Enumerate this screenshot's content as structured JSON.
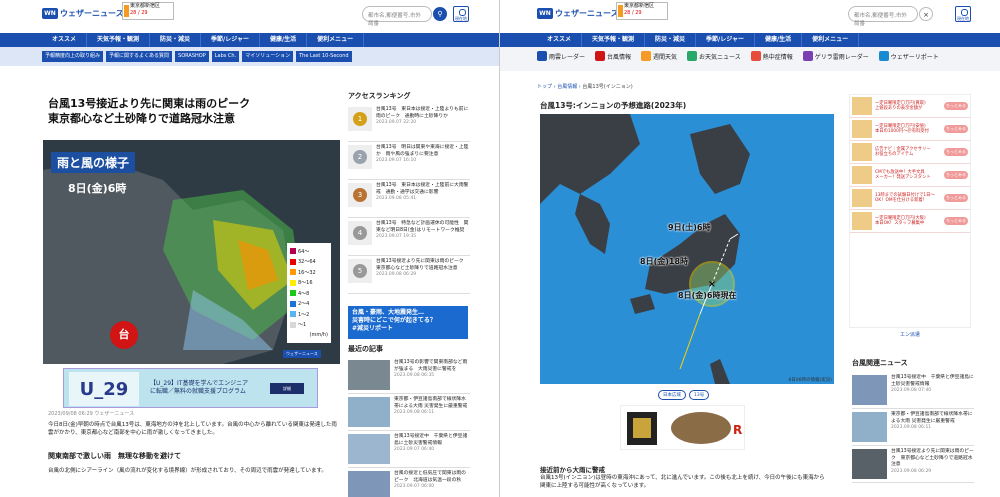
{
  "common": {
    "logo_mark": "WN",
    "logo_text": "ウェザーニュース",
    "weather_badge_location": "東京都新宿区",
    "weather_badge_temp": "28 / 29",
    "search_placeholder": "都市名,郵便番号,市外局番",
    "search_icon": "search-icon",
    "register_label": "現在地",
    "nav": [
      "オススメ",
      "天気予報・観測",
      "防災・減災",
      "季節/レジャー",
      "健康/生活",
      "便利メニュー"
    ]
  },
  "left": {
    "subnav": [
      "予報精度向上の取り組み",
      "予報に関するよくある質問",
      "SORASHOP",
      "Labs Ch.",
      "マイソリューション",
      "The Last 10-Second"
    ],
    "headline": "台風13号接近より先に関東は雨のピーク\n東京都心など土砂降りで道路冠水注意",
    "map": {
      "title": "雨と風の様子",
      "time": "8日(金)6時",
      "legend": [
        {
          "label": "64～",
          "color": "#b4004c"
        },
        {
          "label": "32～64",
          "color": "#e60000"
        },
        {
          "label": "16～32",
          "color": "#ff9900"
        },
        {
          "label": "8～16",
          "color": "#ffee00"
        },
        {
          "label": "4～8",
          "color": "#19c819"
        },
        {
          "label": "2～4",
          "color": "#1976d2"
        },
        {
          "label": "1～2",
          "color": "#5ab4f0"
        },
        {
          "label": "～1",
          "color": "#d8d8d8"
        }
      ],
      "legend_unit": "(mm/h)",
      "typhoon_mark": "台",
      "watermark": "ウェザーニュース"
    },
    "ad": {
      "logo": "U_29",
      "text": "【U_29】IT基礎を学んでエンジニア\nに転職／無料の就職支援プログラム",
      "button": "詳細"
    },
    "date": "2023/09/08 06:29 ウェザーニュース",
    "body1": "今日8日(金)早朝の時点で台風13号は、東海地方の沖を北上しています。台風の中心から離れている関東は発達した雨雲がかかり、東京都心など南部を中心に雨が激しくなってきました。",
    "h3": "関東南部で激しい雨　無理な移動を避けて",
    "body2": "台風の北側にシアーライン（風の流れが変化する境界線）が形成されており、その周辺で雨雲が発達しています。",
    "ranking_title": "アクセスランキング",
    "ranking": [
      {
        "rank": "1",
        "color": "#d4a017",
        "title": "台風13号　東日本は接近・上陸よりも前に雨のピーク　通勤時に土砂降りか",
        "date": "2023.09.07 22:20"
      },
      {
        "rank": "2",
        "color": "#9aa3ad",
        "title": "台風13号　明日は関東や東海に接近・上陸か　雨や風の強まりに要注意",
        "date": "2023.09.07 16:10"
      },
      {
        "rank": "3",
        "color": "#b87333",
        "title": "台風13号　東日本は接近・上陸前に大雨警戒　通勤・通学は交通に影響",
        "date": "2023.09.08 05:41"
      },
      {
        "rank": "4",
        "color": "#888888",
        "title": "台風13号　特急など計画運休の可能性　関東など明日8日(金)はリモートワーク推奨",
        "date": "2023.09.07 19:35"
      },
      {
        "rank": "5",
        "color": "#888888",
        "title": "台風13号接近より先に関東は雨のピーク　東京都心など土砂降りで道路冠水注意",
        "date": "2023.09.08 06:29"
      }
    ],
    "disaster_banner": "台風・豪雨、大地震発生…\n災害時にどこで何が起きてる？\n#減災リポート",
    "recent_title": "最近の記事",
    "recent": [
      {
        "title": "台風13号の影響で関東南部など雨が強まる　大雨災害に警戒を",
        "date": "2023.09.08 06:35"
      },
      {
        "title": "東京都・伊豆諸島南部で線状降水帯による大雨 災害発生に厳重警戒",
        "date": "2023.09.08 06:11"
      },
      {
        "title": "台風13号接近中　千葉県と伊豆諸島に土砂災害警戒情報",
        "date": "2023.09.07 06:40"
      },
      {
        "title": "台風の接近と低気圧で関東は雨のピーク　北海道は気温一段の秋",
        "date": "2023.09.07 06:00"
      }
    ]
  },
  "right": {
    "tabs": [
      {
        "label": "雨雲レーダー",
        "color": "#1a4fb0"
      },
      {
        "label": "台風情報",
        "color": "#d21414"
      },
      {
        "label": "週間天気",
        "color": "#f59a23"
      },
      {
        "label": "お天気ニュース",
        "color": "#2aa86a"
      },
      {
        "label": "熱中症情報",
        "color": "#e74c3c"
      },
      {
        "label": "ゲリラ雷雨レーダー",
        "color": "#7a3fb0"
      },
      {
        "label": "ウェザーリポート",
        "color": "#1a8ad0"
      }
    ],
    "crumb": [
      "トップ",
      "台風情報",
      "台風13号(インニョン)"
    ],
    "title": "台風13号:インニョンの予想進路(2023年)",
    "map": {
      "label9": "9日(土)6時",
      "label8a": "8日(金)18時",
      "label8b": "8日(金)6時現在",
      "caption": "8日06時の情報(実況)"
    },
    "tags": [
      "日本広域",
      "13号"
    ],
    "subh": "接近前から大雨に警戒",
    "body": "台風13号(インニョン)は昼時の東海沖にあって、北に進んでいます。この後も北上を続け、今日の午後にも東海から関東に上陸する可能性が高くなっています。",
    "sidead": [
      {
        "text": "一定日曜限定〇万円(買取)\n上値段ありの表示金額が",
        "btn": "ちっとみる"
      },
      {
        "text": "一定日曜限定〇万円(安値)\n本日の1000円〜＠有料受付",
        "btn": "ちっとみる"
      },
      {
        "text": "広告ナビ｜金属アクセサリー\nお役立ちのアイテム",
        "btn": "ちっとみる"
      },
      {
        "text": "CMでも放送中！大手文具\nメーカー！発送アシスタント",
        "btn": "ちっとみる"
      },
      {
        "text": "13時までの試験日付けで1日〜\nOK！OMを仕分ける新着！",
        "btn": "ちっとみる"
      },
      {
        "text": "一定日曜限定〇万円(大阪)\n本日OK！スタッフ募集中",
        "btn": "ちっとみる"
      }
    ],
    "sidead_foot": "エン派遣",
    "rel_title": "台風関連ニュース",
    "rel": [
      {
        "title": "台風13号接近中　千葉県と伊豆諸島に土砂災害警戒情報",
        "date": "2023.09.08 07:40"
      },
      {
        "title": "東京都・伊豆諸島南部で線状降水帯による大雨 災害発生に厳重警戒",
        "date": "2023.09.08 06:11"
      },
      {
        "title": "台風13号接近より先に関東は雨のピーク　東京都心など土砂降りで道路冠水注意",
        "date": "2023.09.08 06:29"
      }
    ]
  }
}
